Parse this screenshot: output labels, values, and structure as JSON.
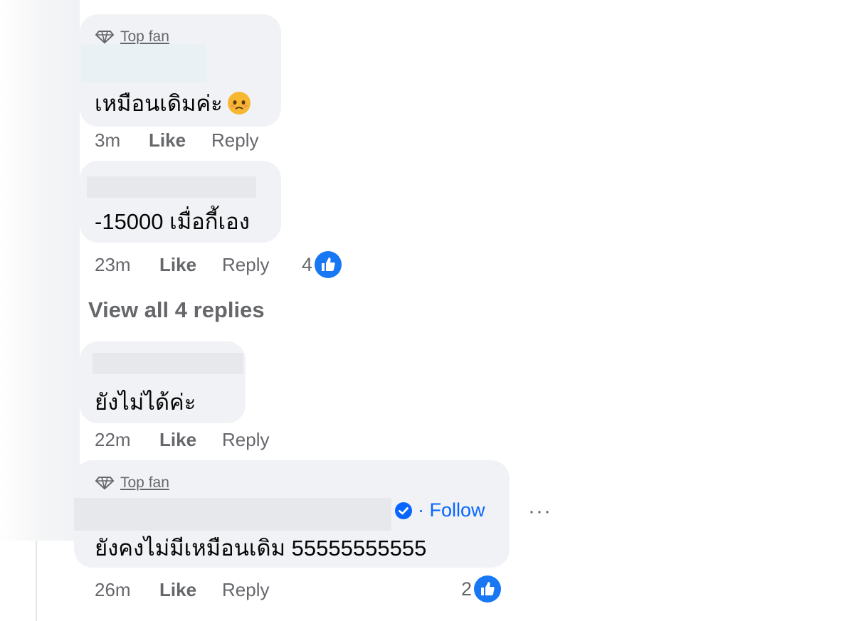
{
  "comments": [
    {
      "badge": "Top fan",
      "text": "เหมือนเดิมค่ะ",
      "emoji_icon": "pleading-face-emoji",
      "time": "3m",
      "like_label": "Like",
      "reply_label": "Reply"
    },
    {
      "text": "-15000 เมื่อกี้เอง",
      "time": "23m",
      "like_label": "Like",
      "reply_label": "Reply",
      "reaction_count": "4",
      "reaction_icon": "like-thumb-icon"
    },
    {
      "text": "ยังไม่ได้ค่ะ",
      "time": "22m",
      "like_label": "Like",
      "reply_label": "Reply"
    },
    {
      "badge": "Top fan",
      "text": "ยังคงไม่มีเหมือนเดิม 55555555555",
      "verified_icon": "verified-check-icon",
      "follow_label": "· Follow",
      "more_label": "···",
      "time": "26m",
      "like_label": "Like",
      "reply_label": "Reply",
      "reaction_count": "2",
      "reaction_icon": "like-thumb-icon"
    }
  ],
  "view_replies_label": "View all 4 replies",
  "colors": {
    "bubble": "#f0f2f5",
    "secondary_text": "#65676b",
    "accent_blue": "#0866ff",
    "like_blue": "#1877f2"
  }
}
